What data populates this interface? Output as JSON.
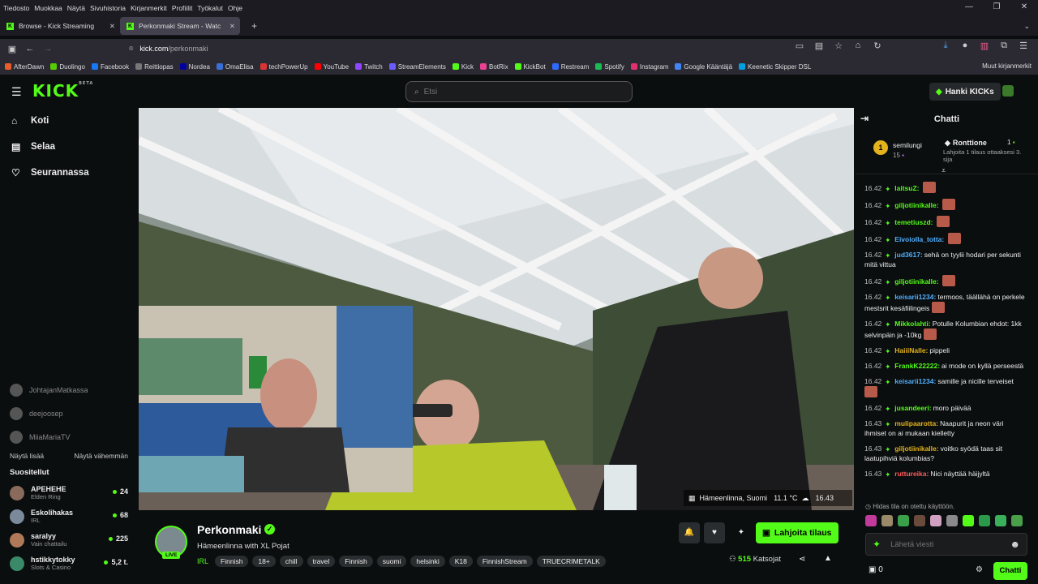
{
  "menubar": [
    "Tiedosto",
    "Muokkaa",
    "Näytä",
    "Sivuhistoria",
    "Kirjanmerkit",
    "Profiilit",
    "Työkalut",
    "Ohje"
  ],
  "tabs": [
    {
      "label": "Browse - Kick Streaming"
    },
    {
      "label": "Perkonmaki Stream - Watc"
    }
  ],
  "url": {
    "host": "kick.com",
    "path": "/perkonmaki"
  },
  "bookmarks": [
    {
      "label": "AfterDawn",
      "color": "#e85d2a"
    },
    {
      "label": "Duolingo",
      "color": "#58cc02"
    },
    {
      "label": "Facebook",
      "color": "#1877f2"
    },
    {
      "label": "Reittiopas",
      "color": "#777777"
    },
    {
      "label": "Nordea",
      "color": "#0000a0"
    },
    {
      "label": "OmaElisa",
      "color": "#3a6fd8"
    },
    {
      "label": "techPowerUp",
      "color": "#d33"
    },
    {
      "label": "YouTube",
      "color": "#ff0000"
    },
    {
      "label": "Twitch",
      "color": "#9146ff"
    },
    {
      "label": "StreamElements",
      "color": "#6b5cff"
    },
    {
      "label": "Kick",
      "color": "#53fc18"
    },
    {
      "label": "BotRix",
      "color": "#e84393"
    },
    {
      "label": "KickBot",
      "color": "#53fc18"
    },
    {
      "label": "Restream",
      "color": "#2d6bff"
    },
    {
      "label": "Spotify",
      "color": "#1db954"
    },
    {
      "label": "Instagram",
      "color": "#e1306c"
    },
    {
      "label": "Google Kääntäjä",
      "color": "#4285f4"
    },
    {
      "label": "Keenetic Skipper DSL",
      "color": "#00a0e0"
    }
  ],
  "bookmarks_other": "Muut kirjanmerkit",
  "kick": {
    "logo": "KICK",
    "logo_beta": "BETA",
    "search_placeholder": "Etsi",
    "get_kicks": "Hanki KICKs"
  },
  "sidebar": {
    "nav": [
      {
        "label": "Koti",
        "icon": "home-icon",
        "glyph": "⌂"
      },
      {
        "label": "Selaa",
        "icon": "browse-icon",
        "glyph": "▤"
      },
      {
        "label": "Seurannassa",
        "icon": "heart-icon",
        "glyph": "♡"
      }
    ],
    "following": [
      {
        "name": "JohtajanMatkassa"
      },
      {
        "name": "deejoosep"
      },
      {
        "name": "MiiaMariaTV"
      }
    ],
    "show_more": "Näytä lisää",
    "show_less": "Näytä vähemmän",
    "recommended_title": "Suositellut",
    "recommended": [
      {
        "name": "APEHEHE",
        "category": "Elden Ring",
        "viewers": "24",
        "color": "#8a6a5a"
      },
      {
        "name": "Eskolihakas",
        "category": "IRL",
        "viewers": "68",
        "color": "#7a8a9a"
      },
      {
        "name": "saralyy",
        "category": "Vain chattailu",
        "viewers": "225",
        "color": "#b07a5a"
      },
      {
        "name": "hstikkytokky",
        "category": "Slots & Casino",
        "viewers": "5,2 t.",
        "color": "#3a8a6a"
      }
    ]
  },
  "video": {
    "location": "Hämeenlinna, Suomi",
    "temperature": "11.1 °C",
    "time": "16.43"
  },
  "stream": {
    "channel": "Perkonmaki",
    "title": "Hämeenlinna with XL Pojat",
    "live_label": "LIVE",
    "category": "IRL",
    "tags": [
      "Finnish",
      "18+",
      "chill",
      "travel",
      "Finnish",
      "suomi",
      "helsinki",
      "K18",
      "FinnishStream",
      "TRUECRIMETALK"
    ],
    "gift_label": "Lahjoita tilaus",
    "viewers": "515",
    "viewers_label": "Katsojat"
  },
  "chat": {
    "title": "Chatti",
    "leaderboard": {
      "rank1_name": "semilungi",
      "rank1_count": "15",
      "rank2_name": "Ronttione",
      "rank2_sub": "Lahjoita 1 tilaus ottaaksesi 3. sija",
      "rank2_count": "1"
    },
    "messages": [
      {
        "time": "16.42",
        "user": "laitsuZ:",
        "color": "#53fc18",
        "text": "",
        "emote": true
      },
      {
        "time": "16.42",
        "user": "giljotiinikalle:",
        "color": "#53fc18",
        "text": "",
        "emote": true
      },
      {
        "time": "16.42",
        "user": "temetiuszd:",
        "color": "#53fc18",
        "text": "",
        "emote": true
      },
      {
        "time": "16.42",
        "user": "Eivoiolla_totta:",
        "color": "#4fb0ff",
        "text": "",
        "emote": true
      },
      {
        "time": "16.42",
        "user": "jud3617:",
        "color": "#4fb0ff",
        "text": "sehä on tyylii hodari per sekunti mitä vittua",
        "emote": false
      },
      {
        "time": "16.42",
        "user": "giljotiinikalle:",
        "color": "#53fc18",
        "text": "",
        "emote": true
      },
      {
        "time": "16.42",
        "user": "keisarii1234:",
        "color": "#4fb0ff",
        "text": "termoos, täällähä on perkele mestsrit kesäfiilingeis",
        "emote": true
      },
      {
        "time": "16.42",
        "user": "Mikkolahti:",
        "color": "#53fc18",
        "text": "Potulle Kolumbian ehdot: 1kk selvinpäin ja -10kg",
        "emote": true
      },
      {
        "time": "16.42",
        "user": "HaiiiNalle:",
        "color": "#e3b21c",
        "text": "pippeli",
        "emote": false
      },
      {
        "time": "16.42",
        "user": "FrankK22222:",
        "color": "#53fc18",
        "text": "ai mode on kyllä perseestä",
        "emote": false
      },
      {
        "time": "16.42",
        "user": "keisarii1234:",
        "color": "#4fb0ff",
        "text": "samille ja nicille terveiset",
        "emote": true
      },
      {
        "time": "16.42",
        "user": "jusandeeri:",
        "color": "#53fc18",
        "text": "moro päivää",
        "emote": false
      },
      {
        "time": "16.43",
        "user": "mulipaarotta:",
        "color": "#e3b21c",
        "text": "Naapurit ja neon väri ihmiset on ai mukaan kielletty",
        "emote": false
      },
      {
        "time": "16.43",
        "user": "giljotiinikalle:",
        "color": "#e3b21c",
        "text": "voitko syödä taas sit laatupihviä kolumbias?",
        "emote": false
      },
      {
        "time": "16.43",
        "user": "ruttureika:",
        "color": "#ff5c5c",
        "text": "Nici näyttää häijyltä",
        "emote": false
      }
    ],
    "slow_mode": "Hidas tila on otettu käyttöön.",
    "input_placeholder": "Lähetä viesti",
    "kicks_count": "0",
    "send_label": "Chatti"
  }
}
